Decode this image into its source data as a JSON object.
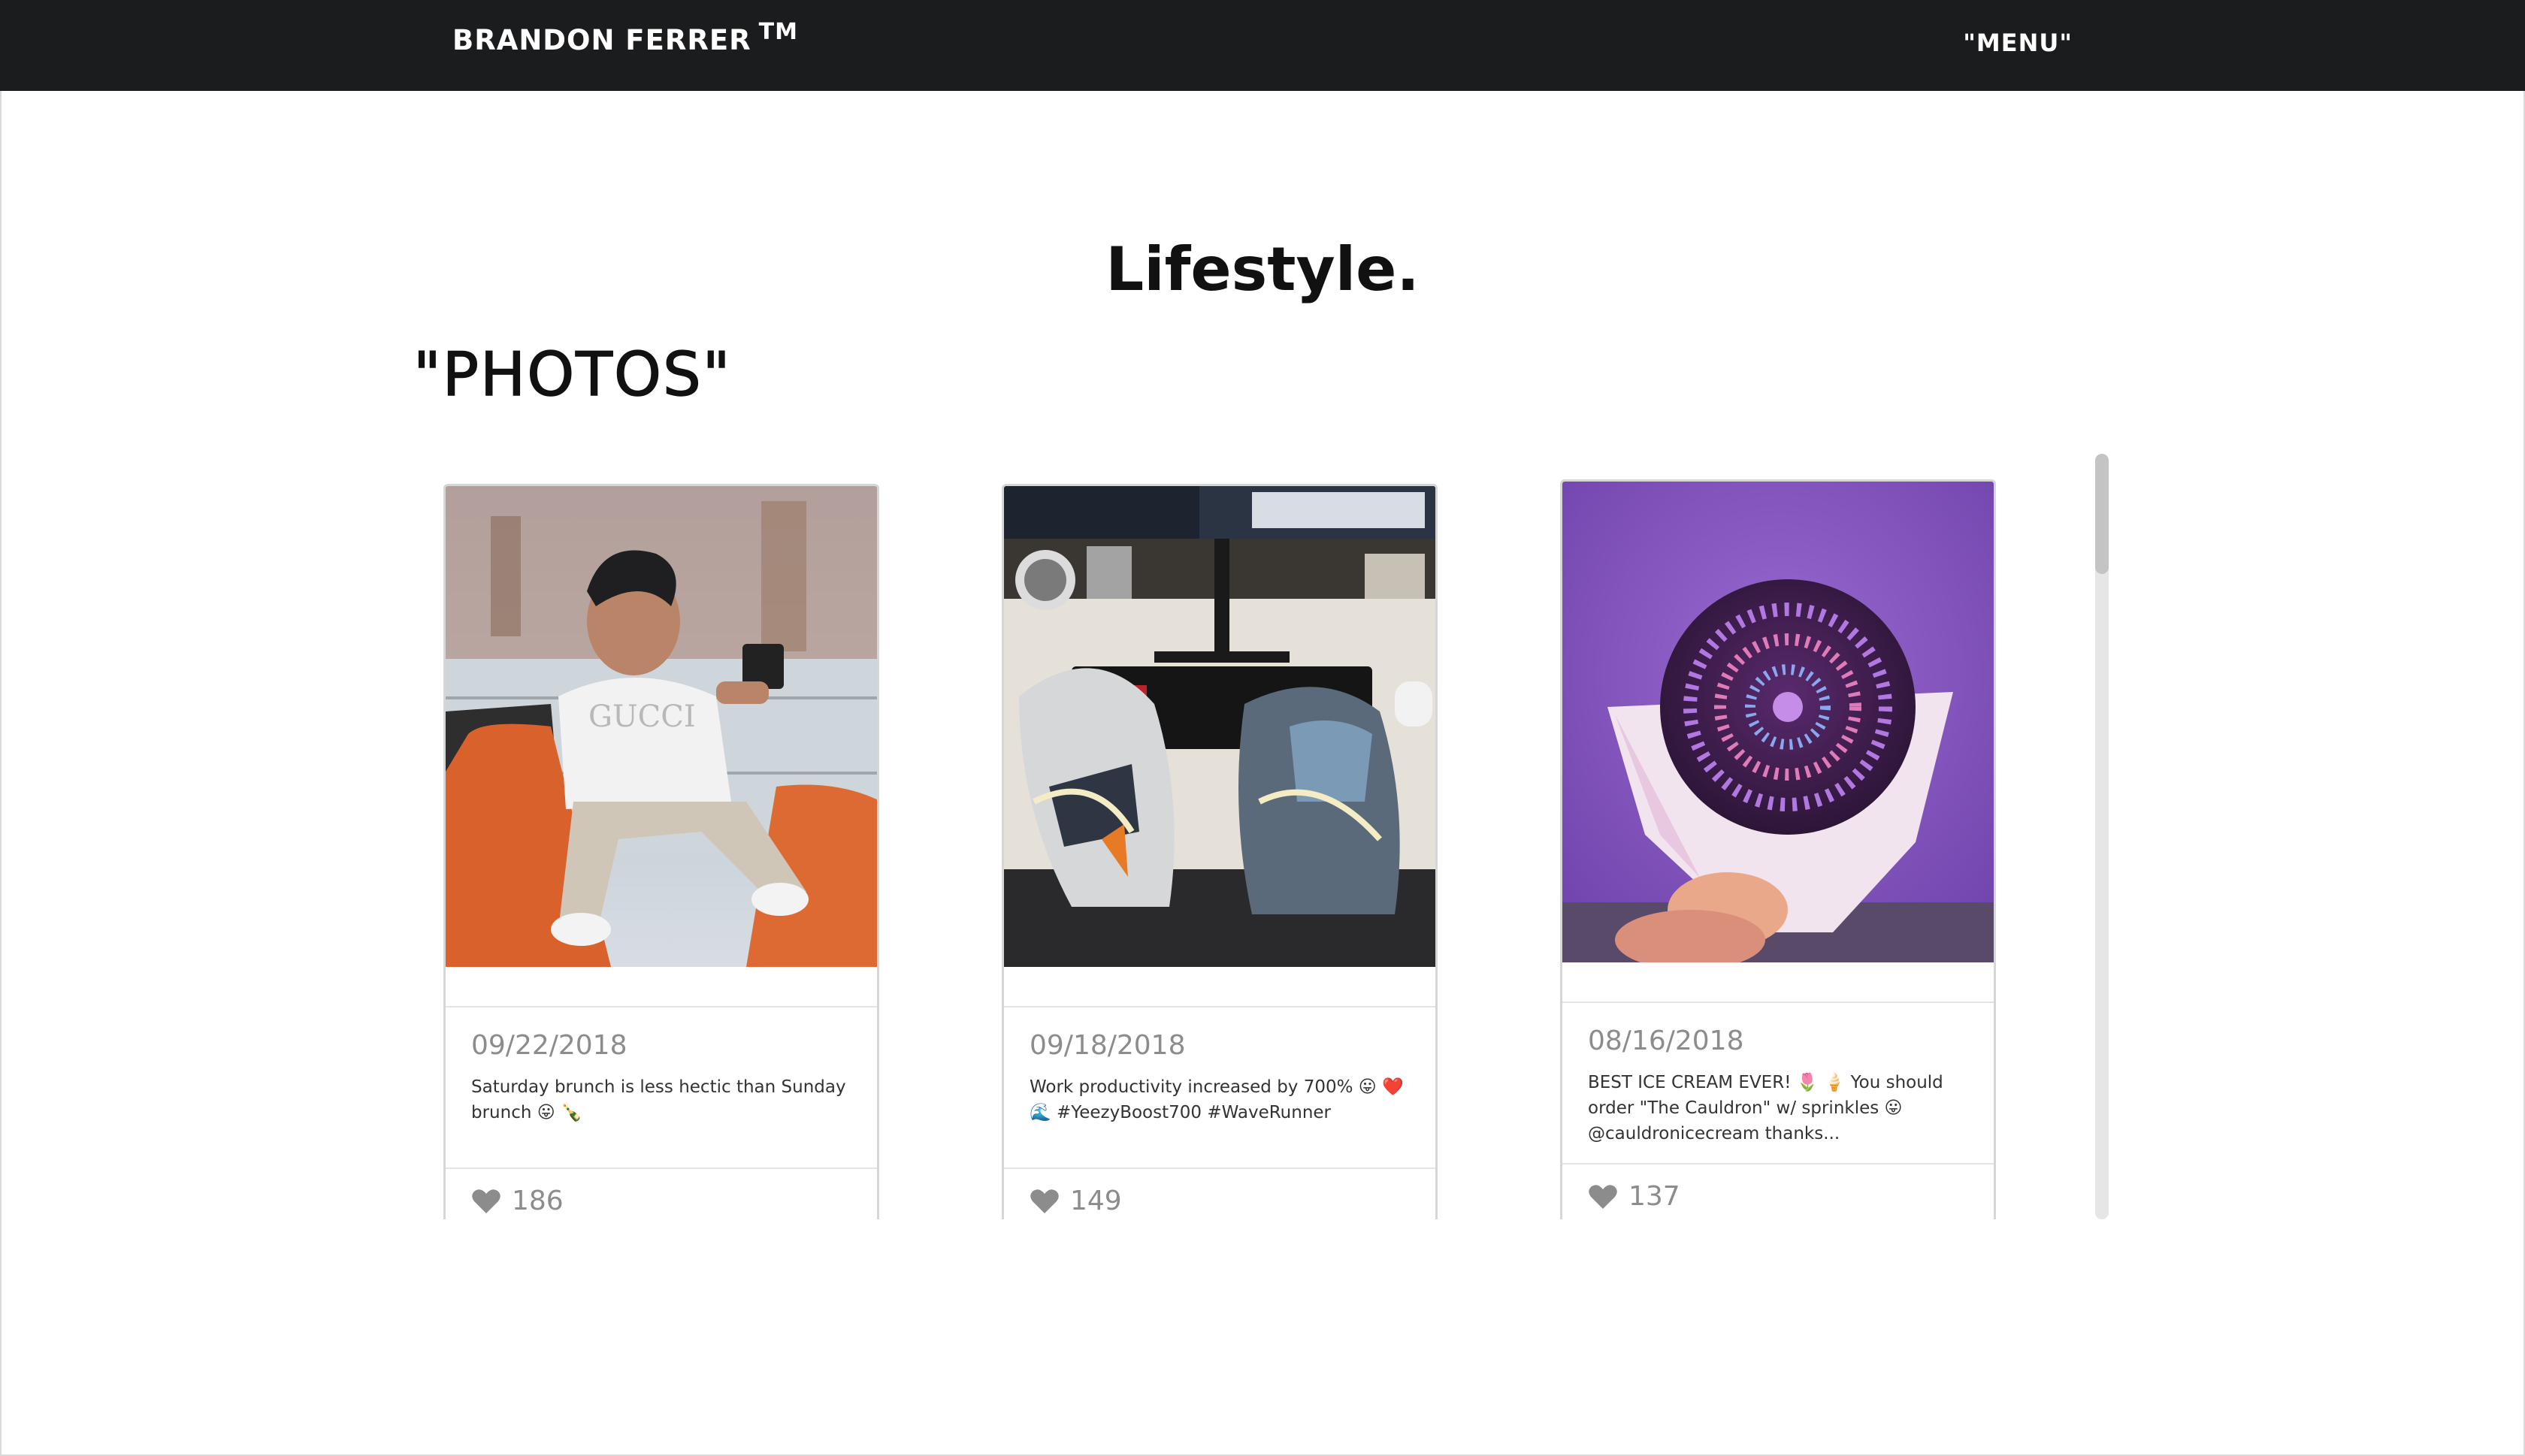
{
  "nav": {
    "brand": "BRANDON FERRER",
    "brand_tm": "TM",
    "menu_label": "\"MENU\""
  },
  "page": {
    "title": "Lifestyle.",
    "subtitle": "\"PHOTOS\""
  },
  "colors": {
    "navbar_bg": "#1b1c1e",
    "heart": "#8c8c8c",
    "meta_text": "#8c8c8c"
  },
  "posts": [
    {
      "date": "09/22/2018",
      "caption": "Saturday brunch is less hectic than Sunday brunch 😛 🍾",
      "likes": "186",
      "photo_icon": "man-on-balcony-photo"
    },
    {
      "date": "09/18/2018",
      "caption": "Work productivity increased by 700% 😛 ❤️ 🌊 #YeezyBoost700 #WaveRunner",
      "likes": "149",
      "photo_icon": "sneakers-on-desk-photo"
    },
    {
      "date": "08/16/2018",
      "caption": "BEST ICE CREAM EVER! 🌷 🍦 You should order \"The Cauldron\" w/ sprinkles 😛 @cauldronicecream thanks...",
      "likes": "137",
      "photo_icon": "ice-cream-cone-photo"
    }
  ]
}
